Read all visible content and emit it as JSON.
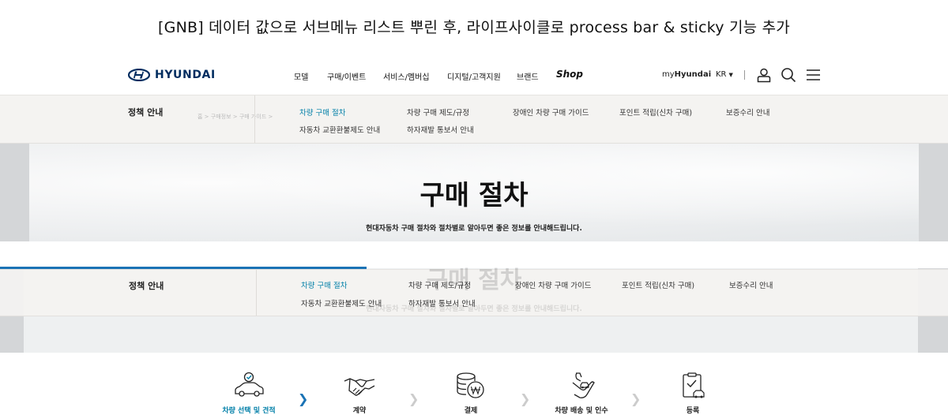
{
  "caption": "[GNB] 데이터 값으로 서브메뉴 리스트 뿌린 후, 라이프사이클로 process bar & sticky 기능 추가",
  "header": {
    "logo_text": "HYUNDAI",
    "menu": [
      "모델",
      "구매/이벤트",
      "서비스/멤버십",
      "디지털/고객지원",
      "브랜드",
      "Shop"
    ],
    "my_prefix": "my",
    "my_bold": "Hyundai",
    "lang": "KR"
  },
  "subnav": {
    "section_title": "정책 안내",
    "items": [
      "차량 구매 절차",
      "차량 구매 제도/규정",
      "장애인 차량 구매 가이드",
      "포인트 적립(신차 구매)",
      "보증수리 안내",
      "자동차 교환환불제도 안내",
      "하자재발 통보서 안내"
    ],
    "active_index": 0,
    "breadcrumb": "홈  >  구매정보  >  구매 가이드  >"
  },
  "hero": {
    "title": "구매 절차",
    "subtitle": "현대자동차 구매 절차와 절차별로 알아두면 좋은 정보를 안내해드립니다."
  },
  "progress": {
    "value_percent": 38.7,
    "color": "#1a73b5"
  },
  "steps": [
    {
      "label": "차량 선택 및 견적",
      "icon": "car-check-icon",
      "active": true
    },
    {
      "label": "계약",
      "icon": "handshake-icon",
      "active": false
    },
    {
      "label": "결제",
      "icon": "coins-won-icon",
      "active": false
    },
    {
      "label": "차량 배송 및 인수",
      "icon": "hand-car-icon",
      "active": false
    },
    {
      "label": "등록",
      "icon": "clipboard-car-icon",
      "active": false
    }
  ],
  "colors": {
    "accent": "#007fa8",
    "brand": "#002c5f",
    "progress": "#1a73b5"
  }
}
